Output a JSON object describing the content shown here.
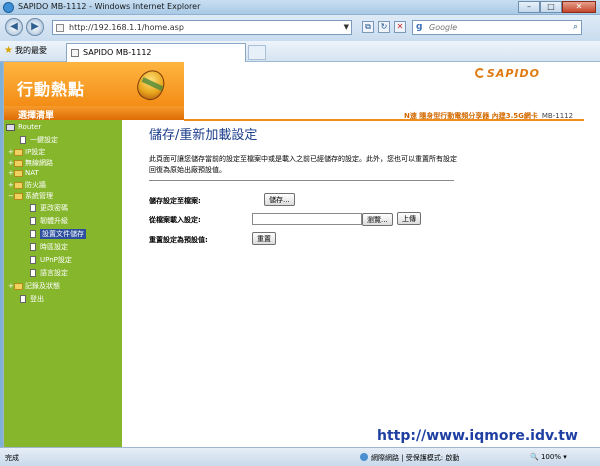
{
  "window": {
    "title": "SAPIDO MB-1112 - Windows Internet Explorer",
    "buttons": {
      "minimize": "–",
      "maximize": "□",
      "close": "✕"
    }
  },
  "nav": {
    "back": "◀",
    "forward": "▶",
    "url": "http://192.168.1.1/home.asp",
    "refresh": "↻",
    "stop": "✕",
    "search_placeholder": "Google"
  },
  "favorites": {
    "label": "我的最愛",
    "tab_title": "SAPIDO MB-1112"
  },
  "header": {
    "app_title": "行動熱點",
    "menu_label": "選擇清單",
    "logo_text": "SAPIDO",
    "product_title": "N速 隨身型行動電頻分享器 內建3.5G網卡",
    "product_model": "MB-1112"
  },
  "sidebar": {
    "root": "Router",
    "items": [
      {
        "label": "一鍵設定"
      },
      {
        "label": "IP設定"
      },
      {
        "label": "無線網路"
      },
      {
        "label": "NAT"
      },
      {
        "label": "防火牆"
      },
      {
        "label": "系統管理"
      },
      {
        "label": "更改密碼"
      },
      {
        "label": "韌體升級"
      },
      {
        "label": "設置文件儲存"
      },
      {
        "label": "時區設定"
      },
      {
        "label": "UPnP設定"
      },
      {
        "label": "語言設定"
      },
      {
        "label": "記錄及狀態"
      },
      {
        "label": "登出"
      }
    ]
  },
  "main": {
    "title": "儲存/重新加載設定",
    "description": "此頁面可讓您儲存當前的設定至檔案中或是載入之前已經儲存的設定。此外，您也可以重置所有設定回復為原始出廠預設值。",
    "save_label": "儲存設定至檔案:",
    "save_button": "儲存...",
    "load_label": "從檔案載入設定:",
    "browse_button": "瀏覽...",
    "upload_button": "上傳",
    "reset_label": "重置設定為預設值:",
    "reset_button": "重置"
  },
  "watermark": "http://www.iqmore.idv.tw",
  "status": {
    "done": "完成",
    "zone": "網際網路 | 受保護模式: 啟動",
    "zoom": "100%"
  }
}
